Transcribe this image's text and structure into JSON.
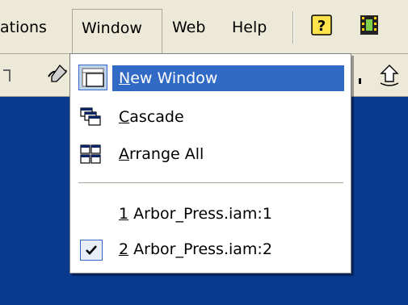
{
  "menubar": {
    "items": [
      {
        "label": "ations"
      },
      {
        "label": "Window"
      },
      {
        "label": "Web"
      },
      {
        "label": "Help"
      }
    ]
  },
  "window_menu": {
    "items": [
      {
        "mnemonic": "N",
        "rest": "ew Window",
        "icon": "new-window-icon"
      },
      {
        "mnemonic": "C",
        "rest": "ascade",
        "icon": "cascade-icon"
      },
      {
        "mnemonic": "A",
        "rest": "rrange All",
        "icon": "arrange-all-icon"
      }
    ],
    "documents": [
      {
        "mnemonic": "1",
        "rest": " Arbor_Press.iam:1",
        "checked": false
      },
      {
        "mnemonic": "2",
        "rest": " Arbor_Press.iam:2",
        "checked": true
      }
    ]
  },
  "colors": {
    "desktop": "#0a3a8e",
    "menu_bg": "#ece9d8",
    "highlight": "#316ac5"
  }
}
